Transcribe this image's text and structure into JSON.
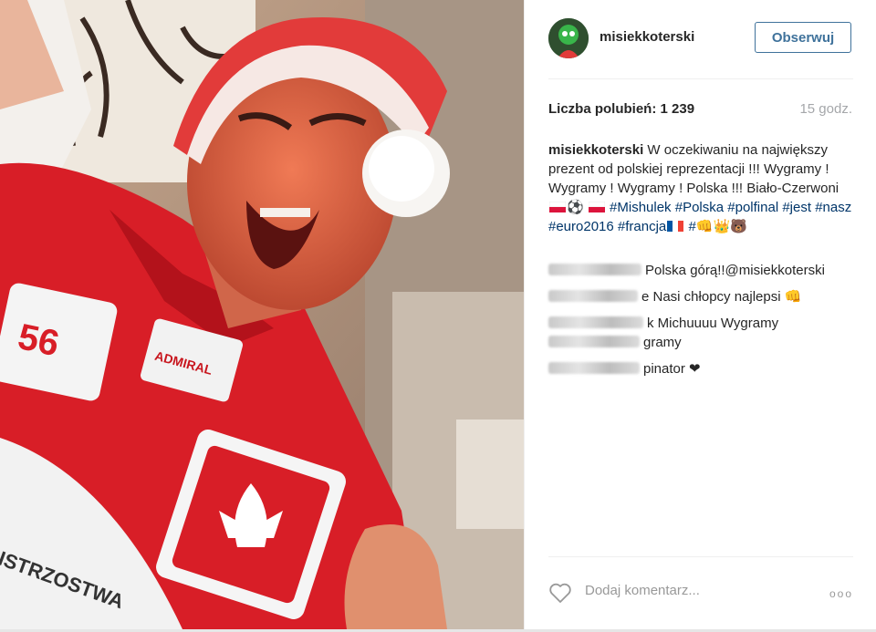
{
  "post": {
    "username": "misiekkoterski",
    "follow_label": "Obserwuj",
    "likes_text": "Liczba polubień: 1 239",
    "time_text": "15 godz.",
    "caption": {
      "user": "misiekkoterski",
      "text_1": " W oczekiwaniu na największy prezent od polskiej reprezentacji !!! Wygramy ! Wygramy ! Wygramy ! Polska !!! Biało-Czerwoni ",
      "emoji_ball": "⚽",
      "tags": [
        "#Mishulek",
        "#Polska",
        "#polfinal",
        "#jest",
        "#nasz",
        "#euro2016",
        "#francja"
      ],
      "tail_tag": "#",
      "emoji_tail": "👊👑🐻"
    },
    "comments": [
      {
        "text": "Polska górą!!@misiekkoterski"
      },
      {
        "text": "e Nasi chłopcy najlepsi 👊"
      },
      {
        "text": "k Michuuuu Wygramy"
      },
      {
        "text": "gramy"
      },
      {
        "text": "pinator ❤"
      }
    ],
    "add_comment_placeholder": "Dodaj komentarz...",
    "more_label": "ooo"
  },
  "colors": {
    "accent": "#3f729b",
    "hashtag": "#003569",
    "muted": "#a5a7aa"
  },
  "icons": {
    "heart": "heart-icon",
    "more": "more-options-icon",
    "flag_pl": "poland-flag-icon",
    "flag_fr": "france-flag-icon"
  }
}
